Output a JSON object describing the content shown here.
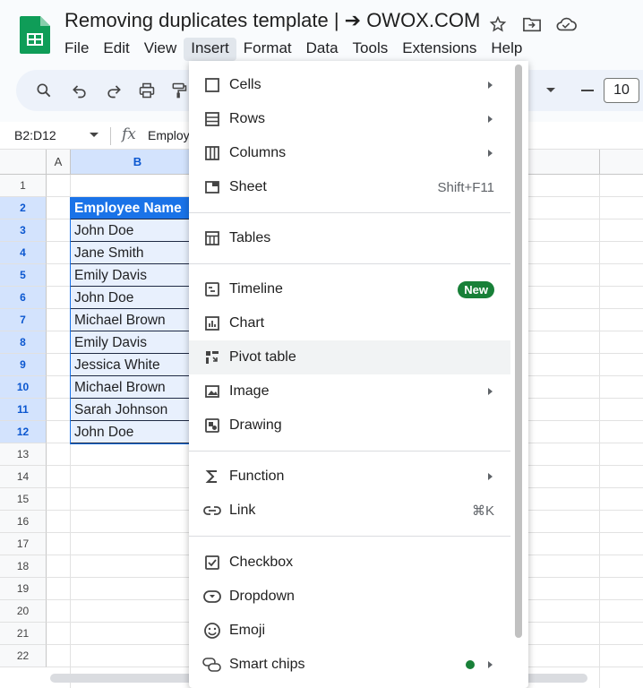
{
  "app": {
    "title": "Removing duplicates template | ➔ OWOX.COM",
    "menus": [
      "File",
      "Edit",
      "View",
      "Insert",
      "Format",
      "Data",
      "Tools",
      "Extensions",
      "Help"
    ],
    "active_menu": "Insert"
  },
  "toolbar": {
    "font_size": "10"
  },
  "formula_bar": {
    "name_box": "B2:D12",
    "fx": "fx",
    "value": "Employ"
  },
  "grid": {
    "columns": [
      "A",
      "B"
    ],
    "rows": [
      "1",
      "2",
      "3",
      "4",
      "5",
      "6",
      "7",
      "8",
      "9",
      "10",
      "11",
      "12",
      "13",
      "14",
      "15",
      "16",
      "17",
      "18",
      "19",
      "20",
      "21",
      "22"
    ],
    "header_cell": "Employee Name",
    "names": [
      "John Doe",
      "Jane Smith",
      "Emily Davis",
      "John Doe",
      "Michael Brown",
      "Emily Davis",
      "Jessica White",
      "Michael Brown",
      "Sarah Johnson",
      "John Doe"
    ]
  },
  "insert_menu": {
    "items": [
      {
        "label": "Cells",
        "icon": "cells-icon"
      },
      {
        "label": "Rows",
        "icon": "rows-icon"
      },
      {
        "label": "Columns",
        "icon": "columns-icon"
      },
      {
        "label": "Sheet",
        "icon": "sheet-icon",
        "shortcut": "Shift+F11"
      },
      {
        "label": "Tables",
        "icon": "tables-icon"
      },
      {
        "label": "Timeline",
        "icon": "timeline-icon",
        "badge": "New"
      },
      {
        "label": "Chart",
        "icon": "chart-icon"
      },
      {
        "label": "Pivot table",
        "icon": "pivot-table-icon"
      },
      {
        "label": "Image",
        "icon": "image-icon"
      },
      {
        "label": "Drawing",
        "icon": "drawing-icon"
      },
      {
        "label": "Function",
        "icon": "function-icon"
      },
      {
        "label": "Link",
        "icon": "link-icon",
        "shortcut": "⌘K"
      },
      {
        "label": "Checkbox",
        "icon": "checkbox-icon"
      },
      {
        "label": "Dropdown",
        "icon": "dropdown-icon"
      },
      {
        "label": "Emoji",
        "icon": "emoji-icon"
      },
      {
        "label": "Smart chips",
        "icon": "smart-chips-icon"
      }
    ]
  },
  "colors": {
    "accent": "#1a73e8",
    "badge_green": "#188038",
    "selection_fill": "#e8f0fd"
  }
}
